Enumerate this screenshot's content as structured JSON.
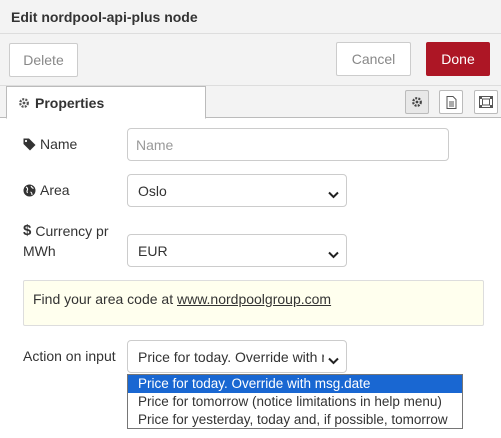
{
  "header": {
    "title": "Edit nordpool-api-plus node"
  },
  "toolbar": {
    "delete_label": "Delete",
    "cancel_label": "Cancel",
    "done_label": "Done"
  },
  "tabs": {
    "properties_label": "Properties"
  },
  "form": {
    "name": {
      "label": "Name",
      "placeholder": "Name",
      "value": ""
    },
    "area": {
      "label": "Area",
      "value": "Oslo"
    },
    "currency": {
      "label_line1": "Currency pr",
      "label_line2": "MWh",
      "value": "EUR"
    },
    "tip": {
      "text": "Find your area code at ",
      "link": "www.nordpoolgroup.com"
    },
    "action": {
      "label": "Action on input",
      "value": "Price for today. Override with msg.date",
      "options": [
        "Price for today. Override with msg.date",
        "Price for tomorrow (notice limitations in help menu)",
        "Price for yesterday, today and, if possible, tomorrow"
      ]
    }
  },
  "colors": {
    "done_button": "#ad1625",
    "selected_option": "#1967d2",
    "tip_background": "#ffffee"
  },
  "icons": [
    "gear-icon",
    "document-icon",
    "appearance-icon",
    "tag-icon",
    "globe-icon",
    "dollar-icon",
    "chevron-down-icon"
  ]
}
